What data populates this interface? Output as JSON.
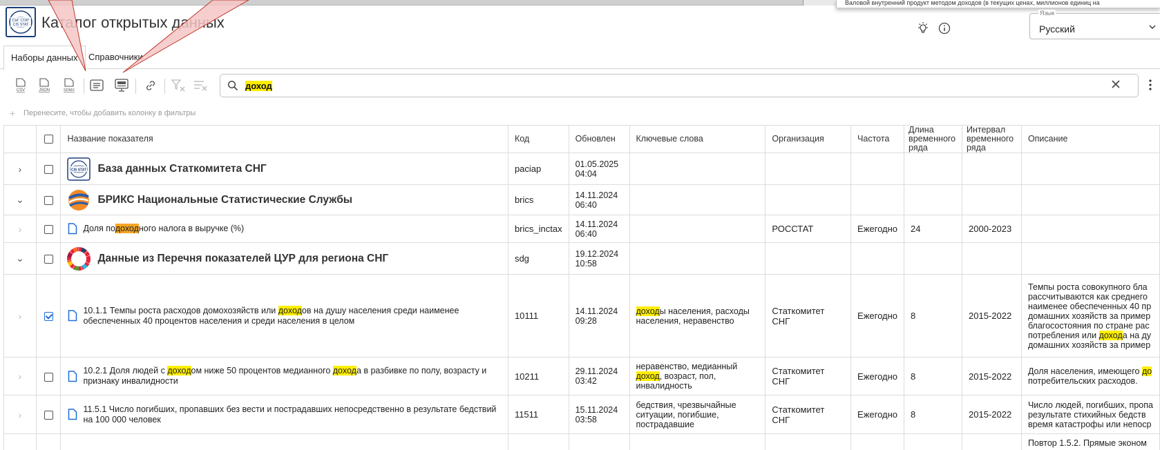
{
  "topbar": {
    "popup_fragment": "Валовой внутренний продукт методом доходов (в текущих ценах, миллионов единиц на"
  },
  "header": {
    "logo_text_top": "СНГ СТАТ",
    "logo_text_bottom": "CIS STAT",
    "title": "Каталог открытых данных",
    "theme_icon": "lightbulb-icon",
    "info_icon": "info-icon",
    "language_label": "Язык",
    "language_value": "Русский"
  },
  "tabs": [
    {
      "label": "Наборы данных",
      "active": true
    },
    {
      "label": "Справочники",
      "active": false
    }
  ],
  "toolbar": {
    "buttons": [
      "csv-export-icon",
      "json-export-icon",
      "sdmx-export-icon",
      "list-view-icon",
      "presentation-icon",
      "link-icon",
      "clear-filter-icon",
      "clear-sort-icon"
    ],
    "csv_label": "CSV",
    "json_label": "JSON",
    "sdmx_label": "SDMX",
    "search_value": "доход"
  },
  "groupbar": {
    "placeholder": "Перенесите, чтобы добавить колонку в фильтры"
  },
  "table": {
    "columns": {
      "name": "Название показателя",
      "code": "Код",
      "updated": "Обновлен",
      "keywords": "Ключевые слова",
      "org": "Организация",
      "freq": "Частота",
      "length": "Длина временного ряда",
      "interval": "Интервал временного ряда",
      "desc": "Описание"
    },
    "groups": {
      "cis": {
        "name": "База данных Статкомитета СНГ",
        "code": "paciap",
        "updated_date": "01.05.2025",
        "updated_time": "04:04"
      },
      "brics": {
        "name": "БРИКС Национальные Статистические Службы",
        "code": "brics",
        "updated_date": "14.11.2024",
        "updated_time": "06:40"
      },
      "sdg": {
        "name": "Данные из Перечня показателей ЦУР для региона СНГ",
        "code": "sdg",
        "updated_date": "19.12.2024",
        "updated_time": "10:58"
      }
    },
    "rows": {
      "brics_inctax": {
        "name_pre": "Доля по",
        "name_hl": "доход",
        "name_post": "ного налога в выручке (%)",
        "code": "brics_inctax",
        "updated_date": "14.11.2024",
        "updated_time": "06:40",
        "org": "РОССТАТ",
        "freq": "Ежегодно",
        "length": "24",
        "interval": "2000-2023"
      },
      "r10111": {
        "name_pre": "10.1.1 Темпы роста расходов домохозяйств или ",
        "name_hl": "доход",
        "name_post": "ов на душу населения среди наименее обеспеченных 40 процентов населения и среди населения в целом",
        "code": "10111",
        "updated_date": "14.11.2024",
        "updated_time": "09:28",
        "kw_hl": "доход",
        "kw_post": "ы населения, расходы населения, неравенство",
        "org": "Статкомитет СНГ",
        "freq": "Ежегодно",
        "length": "8",
        "interval": "2015-2022",
        "desc_1": "Темпы роста совокупного бла",
        "desc_2": "рассчитываются как среднего",
        "desc_3": "наименее обеспеченных 40 пр",
        "desc_4": "домашних хозяйств за пример",
        "desc_5": "благосостояния по стране рас",
        "desc_6_pre": "потребления или ",
        "desc_6_hl": "доход",
        "desc_6_post": "а на ду",
        "desc_7": "домашних хозяйств за пример"
      },
      "r10211": {
        "name_pre": "10.2.1 Доля людей с ",
        "name_hl1": "доход",
        "name_mid": "ом ниже 50 процентов медианного ",
        "name_hl2": "доход",
        "name_post": "а в разбивке по полу, возрасту и признаку инвалидности",
        "code": "10211",
        "updated_date": "29.11.2024",
        "updated_time": "03:42",
        "kw_1": "неравенство, медианный",
        "kw_hl": "доход",
        "kw_post": ", возраст, пол,",
        "kw_3": "инвалидность",
        "org": "Статкомитет СНГ",
        "freq": "Ежегодно",
        "length": "8",
        "interval": "2015-2022",
        "desc_1_pre": "Доля населения, имеющего ",
        "desc_1_hl": "до",
        "desc_2": "потребительских расходов."
      },
      "r11511": {
        "name": "11.5.1 Число погибших, пропавших без вести и пострадавших непосредственно в результате бедствий на 100 000 человек",
        "code": "11511",
        "updated_date": "15.11.2024",
        "updated_time": "03:58",
        "kw_1": "бедствия, чрезвычайные",
        "kw_2": "ситуации, погибшие,",
        "kw_3": "пострадавшие",
        "org": "Статкомитет СНГ",
        "freq": "Ежегодно",
        "length": "8",
        "interval": "2015-2022",
        "desc_1": "Число людей, погибших, пропа",
        "desc_2": "результате стихийных бедств",
        "desc_3": "время катастрофы или непоср"
      },
      "partial": {
        "desc_1": "Повтор 1.5.2. Прямые эконом"
      }
    }
  },
  "colors": {
    "highlight_yellow": "#ffee00",
    "highlight_orange": "#f5a623",
    "accent_blue": "#1e6ed8",
    "annotation_fill": "#f5c6c6",
    "annotation_stroke": "#c0392b"
  }
}
